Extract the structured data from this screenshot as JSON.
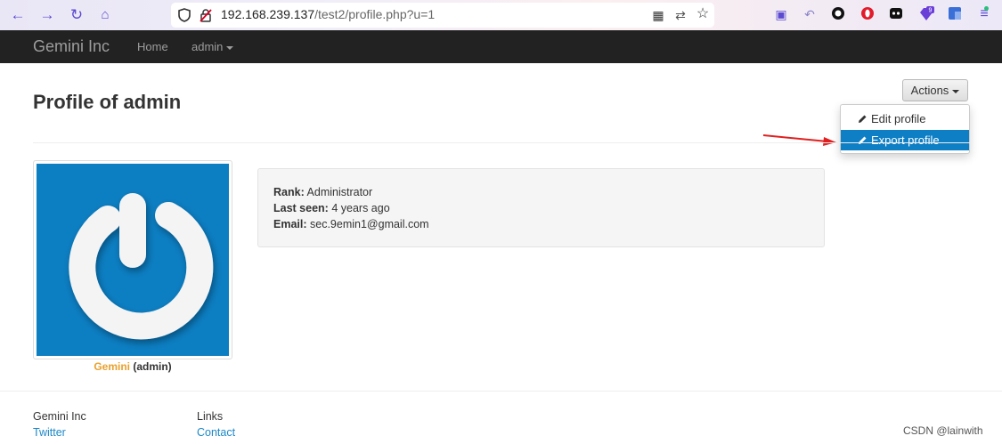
{
  "browser": {
    "url_host": "192.168.239.137",
    "url_path": "/test2/profile.php?u=1",
    "extension_badge": "9"
  },
  "navbar": {
    "brand": "Gemini Inc",
    "home": "Home",
    "user_menu": "admin"
  },
  "page": {
    "title": "Profile of admin",
    "actions_label": "Actions",
    "dropdown": {
      "edit": "Edit profile",
      "export": "Export profile"
    },
    "avatar_caption_name": "Gemini",
    "avatar_caption_user": "(admin)",
    "info": {
      "rank_label": "Rank:",
      "rank_value": "Administrator",
      "seen_label": "Last seen:",
      "seen_value": "4 years ago",
      "email_label": "Email:",
      "email_value": "sec.9emin1@gmail.com"
    }
  },
  "footer": {
    "col1_title": "Gemini Inc",
    "col1_link": "Twitter",
    "col2_title": "Links",
    "col2_link": "Contact"
  },
  "watermark": "CSDN @lainwith",
  "colors": {
    "navbar_bg": "#222222",
    "active_item": "#0e7fc4",
    "avatar_bg": "#0c7ec2",
    "link": "#1e88c7",
    "caption_name": "#e9a12e",
    "arrow": "#e02020"
  }
}
